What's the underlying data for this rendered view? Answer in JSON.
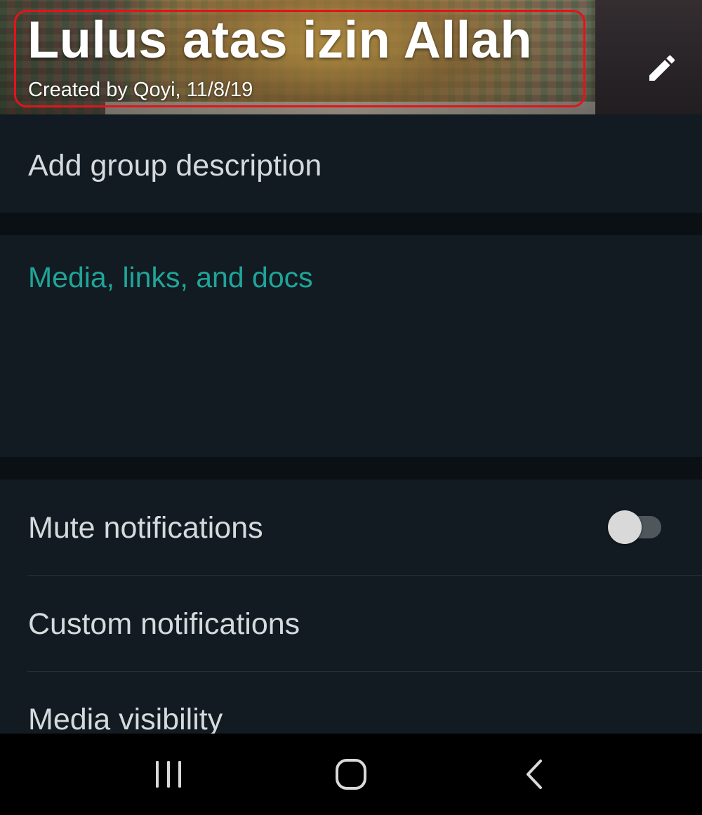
{
  "header": {
    "title": "Lulus atas izin Allah",
    "subtitle": "Created by Qoyi, 11/8/19",
    "edit_icon": "pencil-icon",
    "highlight_color": "#e3131b"
  },
  "description": {
    "label": "Add group description"
  },
  "media": {
    "label": "Media, links, and docs",
    "accent_color": "#1fa59a"
  },
  "settings": [
    {
      "label": "Mute notifications",
      "control": "toggle",
      "toggled": false
    },
    {
      "label": "Custom notifications"
    },
    {
      "label": "Media visibility"
    }
  ],
  "navbar": {
    "recents_icon": "recents-icon",
    "home_icon": "home-icon",
    "back_icon": "back-icon"
  },
  "colors": {
    "background": "#111b21",
    "separator": "#0a1014",
    "text_primary": "#d5dadd",
    "navbar": "#000000"
  }
}
